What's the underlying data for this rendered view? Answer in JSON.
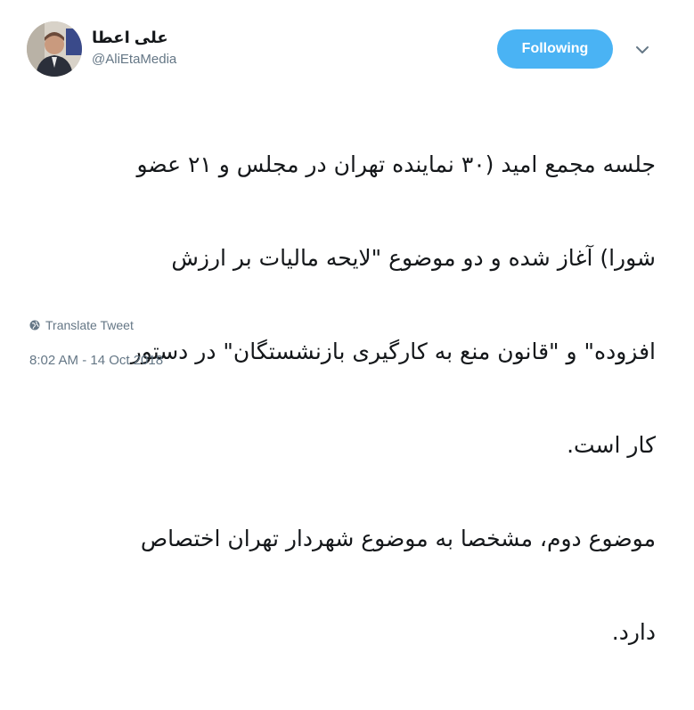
{
  "tweet": {
    "author": {
      "display_name": "علی اعطا",
      "screen_name": "@AliEtaMedia",
      "avatar_icon": "avatar-photo"
    },
    "follow_button_label": "Following",
    "more_icon": "chevron-down-icon",
    "text_lines": [
      "جلسه مجمع امید (۳۰ نماینده تهران در مجلس و ۲۱ عضو",
      "شورا) آغاز شده و دو موضوع \"لایحه مالیات بر ارزش",
      "افزوده\" و \"قانون منع به کارگیری بازنشستگان\" در دستور",
      "کار است.",
      "موضوع دوم، مشخصا به موضوع شهردار تهران اختصاص",
      "دارد."
    ],
    "translate_label": "Translate Tweet",
    "timestamp": "8:02 AM - 14 Oct 2018"
  },
  "colors": {
    "accent": "#4ab3f4",
    "text": "#14171a",
    "secondary_text": "#657786",
    "background": "#ffffff"
  }
}
